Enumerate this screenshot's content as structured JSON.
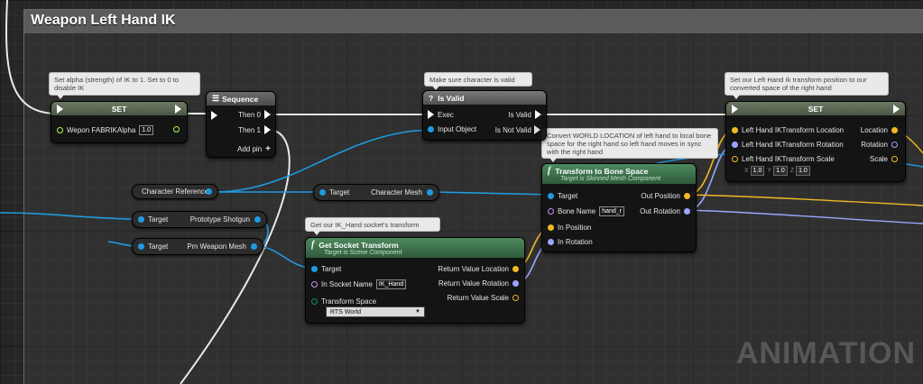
{
  "comment": {
    "title": "Weapon Left Hand IK"
  },
  "bubbles": {
    "set_alpha": "Set alpha (strength) of IK to 1. Set to 0 to disable IK",
    "is_valid": "Make sure character is valid",
    "set_left": "Set our Left Hand Ik transform position to our converted space of the right hand",
    "transform_bone": "Convert WORLD LOCATION of left hand to local bone space for the right hand so left hand moves in sync with the right hand",
    "get_socket": "Get our IK_Hand socket's transform"
  },
  "set_alpha_node": {
    "title": "SET",
    "pin_label": "Wepon FABRIKAlpha",
    "value": "1.0"
  },
  "sequence_node": {
    "title": "Sequence",
    "then0": "Then 0",
    "then1": "Then 1",
    "add_pin": "Add pin",
    "add_icon": "+"
  },
  "is_valid_node": {
    "title": "Is Valid",
    "icon": "?",
    "exec": "Exec",
    "input_object": "Input Object",
    "is_valid": "Is Valid",
    "is_not_valid": "Is Not Valid"
  },
  "set_left_node": {
    "title": "SET",
    "location_in": "Left Hand IKTransform Location",
    "rotation_in": "Left Hand IKTransform Rotation",
    "scale_in": "Left Hand IKTransform Scale",
    "location_out": "Location",
    "rotation_out": "Rotation",
    "scale_out": "Scale",
    "scale_x_label": "X",
    "scale_x": "1.0",
    "scale_y_label": "Y",
    "scale_y": "1.0",
    "scale_z_label": "Z",
    "scale_z": "1.0"
  },
  "transform_bone_node": {
    "icon": "f",
    "title": "Transform to Bone Space",
    "subtitle": "Target is Skinned Mesh Component",
    "target": "Target",
    "bone_name": "Bone Name",
    "bone_value": "hand_r",
    "in_position": "In Position",
    "in_rotation": "In Rotation",
    "out_position": "Out Position",
    "out_rotation": "Out Rotation"
  },
  "get_socket_node": {
    "icon": "f",
    "title": "Get Socket Transform",
    "subtitle": "Target is Scene Component",
    "target": "Target",
    "in_socket": "In Socket Name",
    "socket_value": "IK_Hand",
    "transform_space": "Transform Space",
    "space_value": "RTS World",
    "ret_location": "Return Value Location",
    "ret_rotation": "Return Value Rotation",
    "ret_scale": "Return Value Scale"
  },
  "ref_nodes": {
    "character_reference": "Character Reference",
    "char_mesh_target": "Target",
    "char_mesh_label": "Character Mesh",
    "shotgun_target": "Target",
    "shotgun_label": "Prototype Shotgun",
    "weapon_mesh_target": "Target",
    "weapon_mesh_label": "Pm Weapon Mesh"
  },
  "watermark": "ANIMATION",
  "colors": {
    "exec": "#ffffff",
    "object_pin": "#1e9be0",
    "vector_pin": "#f0b923",
    "rotator_pin": "#9aa6ff",
    "name_pin": "#c58ff7",
    "float_pin": "#a6ff57",
    "enum_pin": "#0f8a73",
    "set_header": "#5f6b58",
    "function_header": "#3e6b4b",
    "sequence_header": "#5e5e5e",
    "isvalid_header": "#6a6a6a"
  }
}
